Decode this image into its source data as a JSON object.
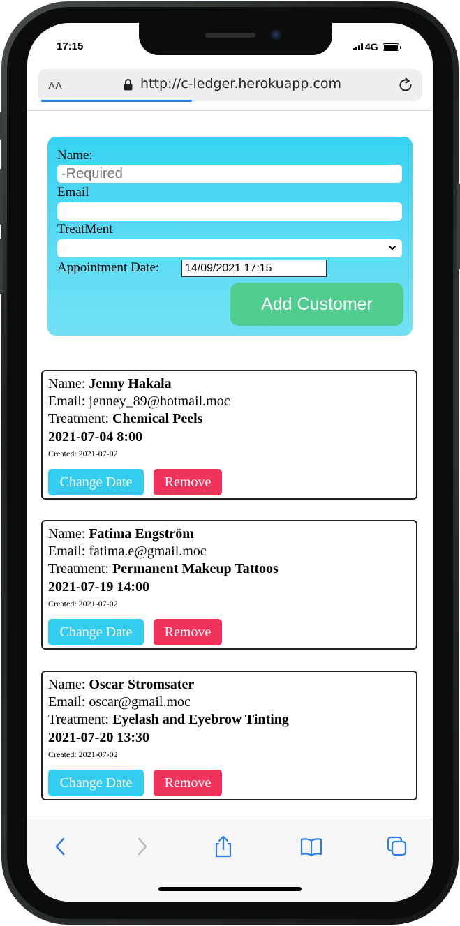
{
  "status_bar": {
    "time": "17:15",
    "network": "4G"
  },
  "browser": {
    "text_size_label": "AA",
    "url": "http://c-ledger.herokuapp.com"
  },
  "form": {
    "name_label": "Name:",
    "name_placeholder": "-Required",
    "email_label": "Email",
    "treatment_label": "TreatMent",
    "treatment_value": "",
    "date_label": "Appointment Date:",
    "date_value": "14/09/2021 17:15",
    "submit_label": "Add Customer"
  },
  "customers": [
    {
      "name_prefix": "Name: ",
      "name": "Jenny Hakala",
      "email_prefix": "Email: ",
      "email": "jenney_89@hotmail.moc",
      "treatment_prefix": "Treatment: ",
      "treatment": "Chemical Peels",
      "appointment": "2021-07-04 8:00",
      "created": "Created: 2021-07-02",
      "change_label": "Change Date",
      "remove_label": "Remove"
    },
    {
      "name_prefix": "Name: ",
      "name": "Fatima Engström",
      "email_prefix": "Email: ",
      "email": "fatima.e@gmail.moc",
      "treatment_prefix": "Treatment: ",
      "treatment": "Permanent Makeup Tattoos",
      "appointment": "2021-07-19 14:00",
      "created": "Created: 2021-07-02",
      "change_label": "Change Date",
      "remove_label": "Remove"
    },
    {
      "name_prefix": "Name: ",
      "name": "Oscar Stromsater",
      "email_prefix": "Email: ",
      "email": "oscar@gmail.moc",
      "treatment_prefix": "Treatment: ",
      "treatment": "Eyelash and Eyebrow Tinting",
      "appointment": "2021-07-20 13:30",
      "created": "Created: 2021-07-02",
      "change_label": "Change Date",
      "remove_label": "Remove"
    }
  ],
  "toolbar": {
    "icons": [
      "back-icon",
      "forward-icon",
      "share-icon",
      "bookmarks-icon",
      "tabs-icon"
    ]
  },
  "colors": {
    "form_gradient_top": "#37d3f2",
    "form_gradient_bottom": "#71e1f5",
    "add_button": "#4fcc8e",
    "change_button": "#34cdf0",
    "remove_button": "#f0335a",
    "toolbar_icon": "#2d7de6"
  }
}
